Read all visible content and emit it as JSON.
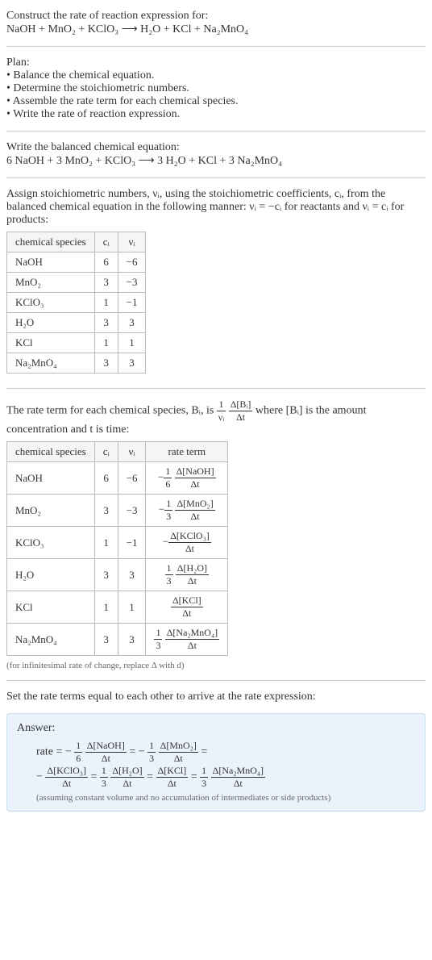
{
  "intro": {
    "line1": "Construct the rate of reaction expression for:",
    "equation": "NaOH + MnO₂ + KClO₃ ⟶ H₂O + KCl + Na₂MnO₄"
  },
  "plan": {
    "title": "Plan:",
    "b1": "• Balance the chemical equation.",
    "b2": "• Determine the stoichiometric numbers.",
    "b3": "• Assemble the rate term for each chemical species.",
    "b4": "• Write the rate of reaction expression."
  },
  "balanced": {
    "title": "Write the balanced chemical equation:",
    "equation": "6 NaOH + 3 MnO₂ + KClO₃ ⟶ 3 H₂O + KCl + 3 Na₂MnO₄"
  },
  "stoich": {
    "intro": "Assign stoichiometric numbers, νᵢ, using the stoichiometric coefficients, cᵢ, from the balanced chemical equation in the following manner: νᵢ = −cᵢ for reactants and νᵢ = cᵢ for products:",
    "headers": {
      "h1": "chemical species",
      "h2": "cᵢ",
      "h3": "νᵢ"
    },
    "rows": [
      {
        "sp": "NaOH",
        "c": "6",
        "v": "−6"
      },
      {
        "sp": "MnO₂",
        "c": "3",
        "v": "−3"
      },
      {
        "sp": "KClO₃",
        "c": "1",
        "v": "−1"
      },
      {
        "sp": "H₂O",
        "c": "3",
        "v": "3"
      },
      {
        "sp": "KCl",
        "c": "1",
        "v": "1"
      },
      {
        "sp": "Na₂MnO₄",
        "c": "3",
        "v": "3"
      }
    ]
  },
  "rateterm": {
    "intro_a": "The rate term for each chemical species, Bᵢ, is ",
    "frac1_num": "1",
    "frac1_den": "νᵢ",
    "frac2_num": "Δ[Bᵢ]",
    "frac2_den": "Δt",
    "intro_b": " where [Bᵢ] is the amount concentration and t is time:",
    "headers": {
      "h1": "chemical species",
      "h2": "cᵢ",
      "h3": "νᵢ",
      "h4": "rate term"
    },
    "rows": [
      {
        "sp": "NaOH",
        "c": "6",
        "v": "−6",
        "sign": "−",
        "coef_num": "1",
        "coef_den": "6",
        "dnum": "Δ[NaOH]",
        "dden": "Δt"
      },
      {
        "sp": "MnO₂",
        "c": "3",
        "v": "−3",
        "sign": "−",
        "coef_num": "1",
        "coef_den": "3",
        "dnum": "Δ[MnO₂]",
        "dden": "Δt"
      },
      {
        "sp": "KClO₃",
        "c": "1",
        "v": "−1",
        "sign": "−",
        "coef_num": "",
        "coef_den": "",
        "dnum": "Δ[KClO₃]",
        "dden": "Δt"
      },
      {
        "sp": "H₂O",
        "c": "3",
        "v": "3",
        "sign": "",
        "coef_num": "1",
        "coef_den": "3",
        "dnum": "Δ[H₂O]",
        "dden": "Δt"
      },
      {
        "sp": "KCl",
        "c": "1",
        "v": "1",
        "sign": "",
        "coef_num": "",
        "coef_den": "",
        "dnum": "Δ[KCl]",
        "dden": "Δt"
      },
      {
        "sp": "Na₂MnO₄",
        "c": "3",
        "v": "3",
        "sign": "",
        "coef_num": "1",
        "coef_den": "3",
        "dnum": "Δ[Na₂MnO₄]",
        "dden": "Δt"
      }
    ],
    "note": "(for infinitesimal rate of change, replace Δ with d)"
  },
  "final": {
    "intro": "Set the rate terms equal to each other to arrive at the rate expression:"
  },
  "answer": {
    "label": "Answer:",
    "rate_label": "rate = −",
    "t1_num": "1",
    "t1_den": "6",
    "t1_dn": "Δ[NaOH]",
    "t1_dd": "Δt",
    "eq1": " = −",
    "t2_num": "1",
    "t2_den": "3",
    "t2_dn": "Δ[MnO₂]",
    "t2_dd": "Δt",
    "eq2": " =",
    "line2_start": "−",
    "t3_dn": "Δ[KClO₃]",
    "t3_dd": "Δt",
    "eq3": " = ",
    "t4_num": "1",
    "t4_den": "3",
    "t4_dn": "Δ[H₂O]",
    "t4_dd": "Δt",
    "eq4": " = ",
    "t5_dn": "Δ[KCl]",
    "t5_dd": "Δt",
    "eq5": " = ",
    "t6_num": "1",
    "t6_den": "3",
    "t6_dn": "Δ[Na₂MnO₄]",
    "t6_dd": "Δt",
    "note": "(assuming constant volume and no accumulation of intermediates or side products)"
  }
}
